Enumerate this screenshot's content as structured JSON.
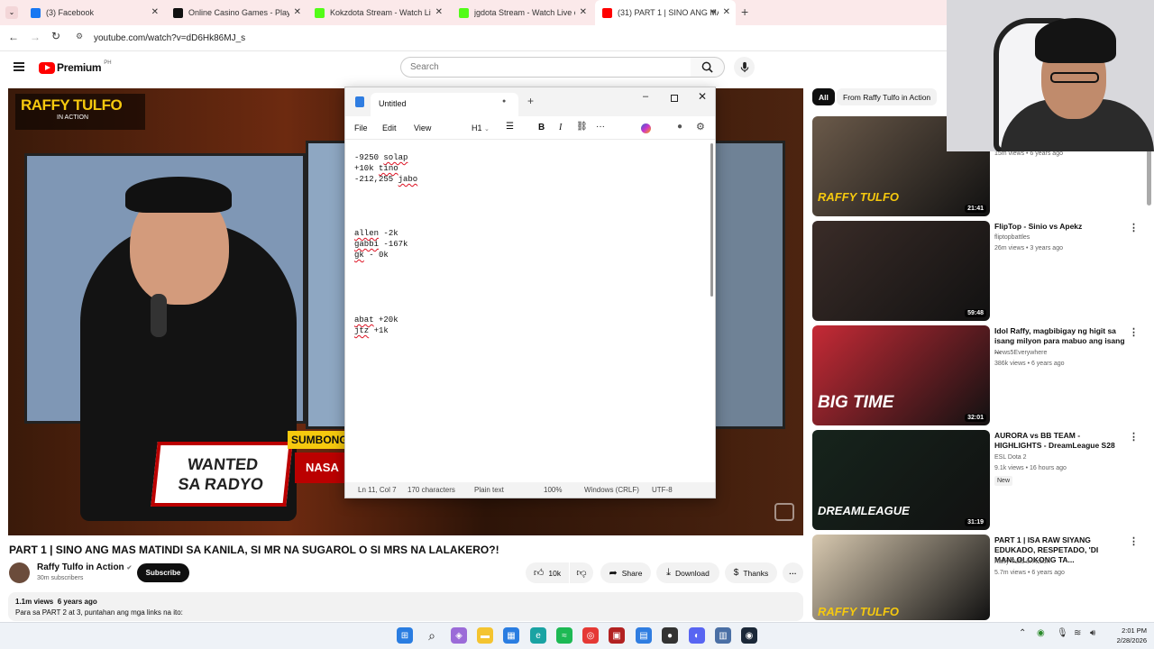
{
  "browser": {
    "tabs": [
      {
        "title": "(3) Facebook",
        "icon": "facebook-icon",
        "color": "#1877f2"
      },
      {
        "title": "Online Casino Games - Play Fre",
        "icon": "casino-icon",
        "color": "#111111"
      },
      {
        "title": "Kokzdota Stream - Watch Live o",
        "icon": "kick-icon",
        "color": "#53fc18"
      },
      {
        "title": "jgdota Stream - Watch Live on",
        "icon": "kick-icon",
        "color": "#53fc18"
      },
      {
        "title": "(31) PART 1 | SINO ANG MA",
        "icon": "youtube-icon",
        "color": "#ff0000"
      }
    ],
    "url": "youtube.com/watch?v=dD6Hk86MJ_s"
  },
  "youtube": {
    "logo_text": "Premium",
    "region": "PH",
    "search_placeholder": "Search",
    "video": {
      "show_logo_top": "RAFFY TULFO",
      "show_logo_bottom": "IN ACTION",
      "banner_left_1": "WANTED",
      "banner_left_2": "SA RADYO",
      "banner_right_top": "SUMBONG",
      "banner_right_bottom": "NASA"
    },
    "title": "PART 1 | SINO ANG MAS MATINDI SA KANILA, SI MR NA SUGAROL O SI MRS NA LALAKERO?!",
    "channel": "Raffy Tulfo in Action",
    "subscribers": "30m subscribers",
    "subscribe_label": "Subscribe",
    "likes": "10k",
    "share_label": "Share",
    "download_label": "Download",
    "thanks_label": "Thanks",
    "views_line": "1.1m views  6 years ago",
    "description": "Para sa PART 2 at 3, puntahan ang mga links na ito:",
    "chips": [
      "All",
      "From Raffy Tulfo in Action"
    ],
    "related": [
      {
        "title": "",
        "channel": "",
        "meta": "15m views • 6 years ago",
        "duration": "21:41",
        "thumb_text": "RAFFY TULFO",
        "thumb_color": "#6b5a4a"
      },
      {
        "title": "FlipTop - Sinio vs Apekz",
        "channel": "fliptopbattles",
        "meta": "26m views • 3 years ago",
        "duration": "59:48",
        "thumb_text": "",
        "thumb_color": "#3a2c28"
      },
      {
        "title": "Idol Raffy, magbibigay ng higit sa isang milyon para mabuo ang isang ...",
        "channel": "News5Everywhere",
        "meta": "386k views • 6 years ago",
        "duration": "32:01",
        "thumb_text": "BIG TIME",
        "thumb_color": "#c62a36"
      },
      {
        "title": "AURORA vs BB TEAM - HIGHLIGHTS - DreamLeague S28",
        "channel": "ESL Dota 2",
        "meta": "9.1k views • 16 hours ago",
        "badge": "New",
        "duration": "31:19",
        "thumb_text": "DREAMLEAGUE",
        "thumb_color": "#16241c"
      },
      {
        "title": "PART 1 | ISA RAW SIYANG EDUKADO, RESPETADO, 'DI MANLOLOKONG TA...",
        "channel": "Raffy Tulfo in Action",
        "meta": "5.7m views • 6 years ago",
        "duration": "",
        "thumb_text": "RAFFY TULFO",
        "thumb_color": "#d8c9b0"
      }
    ]
  },
  "notepad": {
    "tab_title": "Untitled",
    "menu": [
      "File",
      "Edit",
      "View"
    ],
    "heading_label": "H1",
    "lines": [
      [
        "-9250 ",
        {
          "w": "solap"
        }
      ],
      [
        "+10k ",
        {
          "w": "tino"
        }
      ],
      [
        "-212,255 ",
        {
          "w": "jabo"
        }
      ],
      [
        ""
      ],
      [
        ""
      ],
      [
        ""
      ],
      [
        ""
      ],
      [
        {
          "w": "allen"
        },
        " -2k"
      ],
      [
        {
          "w": "gabbi"
        },
        " -167k"
      ],
      [
        {
          "w": "gk"
        },
        " - 0k"
      ],
      [
        ""
      ],
      [
        ""
      ],
      [
        ""
      ],
      [
        ""
      ],
      [
        ""
      ],
      [
        {
          "w": "abat"
        },
        " +20k"
      ],
      [
        {
          "w": "jtz"
        },
        " +1k"
      ]
    ],
    "status": {
      "position": "Ln 11, Col 7",
      "chars": "170 characters",
      "format": "Plain text",
      "zoom": "100%",
      "eol": "Windows (CRLF)",
      "encoding": "UTF-8"
    }
  },
  "taskbar": {
    "time": "2:01 PM",
    "date": "2/28/2026"
  }
}
